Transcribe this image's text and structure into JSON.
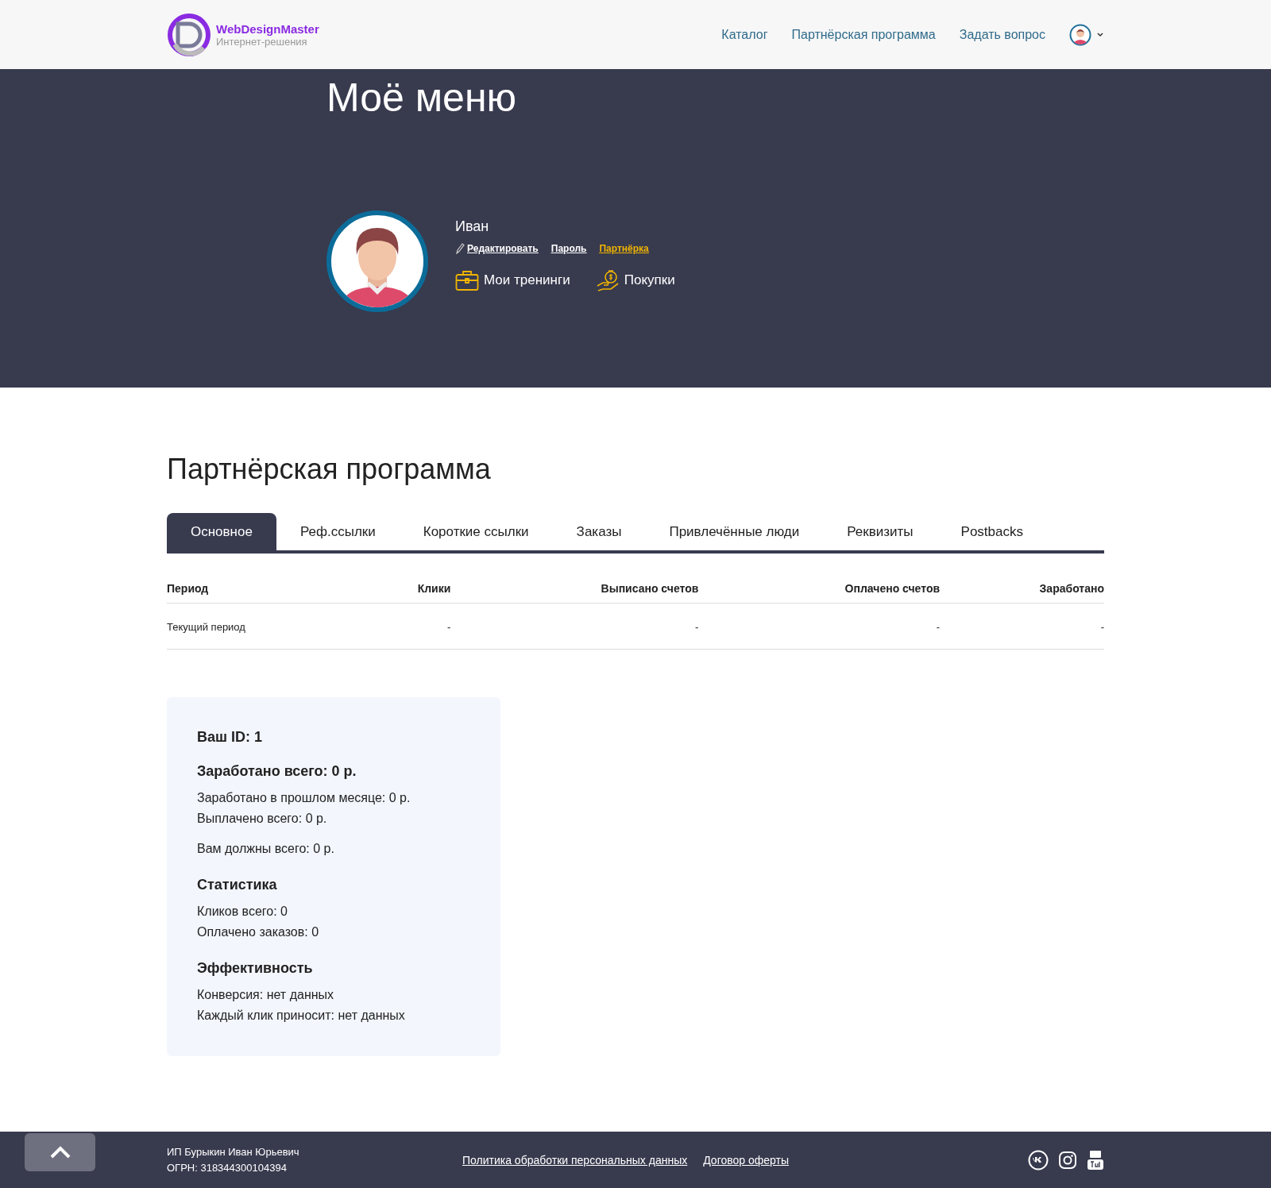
{
  "header": {
    "logo": {
      "name": "WebDesignMaster",
      "tagline": "Интернет-решения"
    },
    "nav": [
      "Каталог",
      "Партнёрская программа",
      "Задать вопрос"
    ]
  },
  "hero": {
    "title": "Моё меню",
    "user": {
      "name": "Иван",
      "links": [
        {
          "label": "Редактировать",
          "kind": "edit",
          "selected": false
        },
        {
          "label": "Пароль",
          "kind": "plain",
          "selected": false
        },
        {
          "label": "Партнёрка",
          "kind": "plain",
          "selected": true
        }
      ]
    },
    "actions": [
      {
        "label": "Мои тренинги",
        "kind": "briefcase"
      },
      {
        "label": "Покупки",
        "kind": "money"
      }
    ]
  },
  "section_title": "Партнёрская программа",
  "tabs": [
    {
      "label": "Основное",
      "selected": true
    },
    {
      "label": "Реф.ссылки",
      "selected": false
    },
    {
      "label": "Короткие ссылки",
      "selected": false
    },
    {
      "label": "Заказы",
      "selected": false
    },
    {
      "label": "Привлечённые люди",
      "selected": false
    },
    {
      "label": "Реквизиты",
      "selected": false
    },
    {
      "label": "Postbacks",
      "selected": false
    }
  ],
  "table": {
    "columns": [
      "Период",
      "Клики",
      "Выписано счетов",
      "Оплачено счетов",
      "Заработано"
    ],
    "rows": [
      [
        "Текущий период",
        "-",
        "-",
        "-",
        "-"
      ]
    ]
  },
  "summary": [
    {
      "heading": "Ваш ID: 1"
    },
    {
      "heading": "Заработано всего: 0 р.",
      "paragraphs": [
        [
          "Заработано в прошлом месяце: 0 р.",
          "Выплачено всего: 0 р."
        ],
        [
          "Вам должны всего: 0 р."
        ]
      ]
    },
    {
      "heading": "Статистика",
      "paragraphs": [
        [
          "Кликов всего: 0",
          "Оплачено заказов: 0"
        ]
      ]
    },
    {
      "heading": "Эффективность",
      "paragraphs": [
        [
          "Конверсия: нет данных",
          "Каждый клик приносит: нет данных"
        ]
      ]
    }
  ],
  "footer": {
    "company": [
      "ИП Бурыкин Иван Юрьевич",
      "ОГРН: 318344300104394"
    ],
    "links": [
      "Политика обработки персональных данных",
      "Договор оферты"
    ]
  }
}
